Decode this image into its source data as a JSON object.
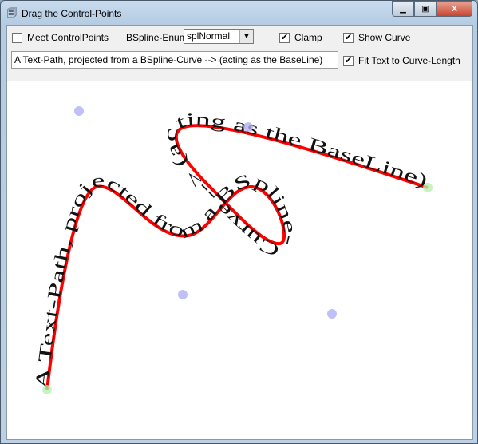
{
  "window": {
    "title": "Drag the Control-Points",
    "icon": "app-icon"
  },
  "controls": {
    "meet_control_points": {
      "label": "Meet ControlPoints",
      "checked": false
    },
    "bspline_enum": {
      "label": "BSpline-Enum",
      "value": "splNormal"
    },
    "clamp": {
      "label": "Clamp",
      "checked": true
    },
    "show_curve": {
      "label": "Show Curve",
      "checked": true
    },
    "fit_text": {
      "label": "Fit Text to Curve-Length",
      "checked": true
    },
    "text_input": {
      "value": "A Text-Path, projected from a BSpline-Curve --> (acting as the BaseLine)"
    }
  },
  "colors": {
    "curve": "#ff0000",
    "control_point": "#c0c0f8",
    "endpoint": "#b8f0b0"
  }
}
